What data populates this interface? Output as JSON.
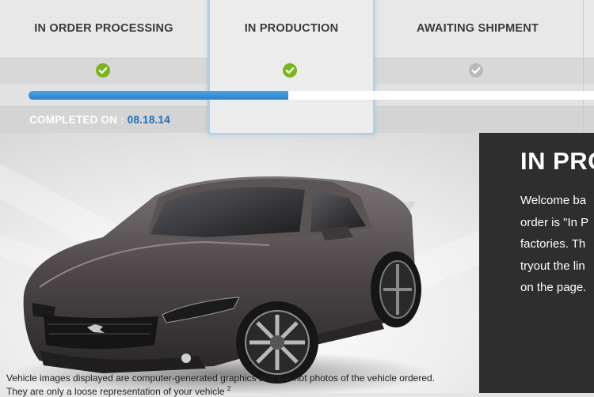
{
  "tracker": {
    "steps": [
      {
        "label": "IN ORDER PROCESSING",
        "status": "complete"
      },
      {
        "label": "IN PRODUCTION",
        "status": "complete"
      },
      {
        "label": "AWAITING SHIPMENT",
        "status": "pending"
      }
    ],
    "progress_fraction": 0.46,
    "completed_label": "COMPLETED ON :",
    "completed_date": "08.18.14"
  },
  "hero": {
    "panel_title": "IN PRO",
    "panel_lines": [
      "Welcome ba",
      "order is \"In P",
      "factories. Th",
      "tryout the lin",
      "on the page."
    ],
    "disclaimer_line1": "Vehicle images displayed are computer-generated graphics and are not photos of the vehicle ordered.",
    "disclaimer_line2": "They are only a loose representation of your vehicle",
    "disclaimer_sup": "2"
  },
  "colors": {
    "check_complete": "#7ab51d",
    "check_pending": "#b9b9b9",
    "progress": "#2f8ad3",
    "date": "#1f6fb3",
    "panel_bg": "#2e2e2e"
  },
  "icons": {
    "complete": "check-circle-icon",
    "pending": "check-circle-gray-icon"
  }
}
